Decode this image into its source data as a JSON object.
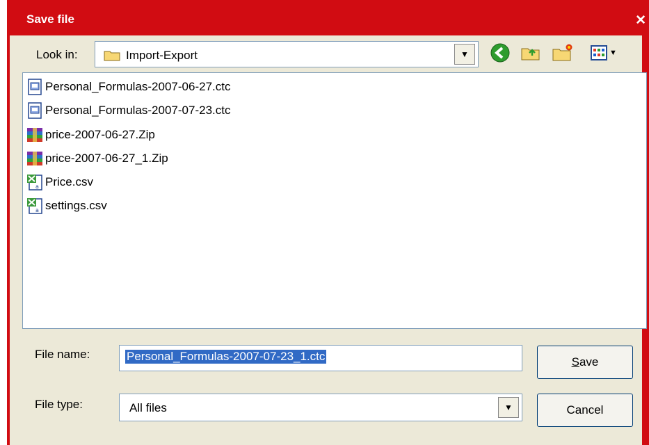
{
  "window": {
    "title": "Save file"
  },
  "toolbar": {
    "look_in_label": "Look in:",
    "look_in_value": "Import-Export",
    "buttons": [
      "back-icon",
      "up-folder-icon",
      "new-folder-icon",
      "view-menu-icon"
    ]
  },
  "files": [
    {
      "name": "Personal_Formulas-2007-06-27.ctc",
      "icon": "ctc-file-icon"
    },
    {
      "name": "Personal_Formulas-2007-07-23.ctc",
      "icon": "ctc-file-icon"
    },
    {
      "name": "price-2007-06-27.Zip",
      "icon": "zip-archive-icon"
    },
    {
      "name": "price-2007-06-27_1.Zip",
      "icon": "zip-archive-icon"
    },
    {
      "name": "Price.csv",
      "icon": "csv-file-icon"
    },
    {
      "name": "settings.csv",
      "icon": "csv-file-icon"
    }
  ],
  "form": {
    "file_name_label": "File name:",
    "file_name_value": "Personal_Formulas-2007-07-23_1.ctc",
    "file_type_label": "File type:",
    "file_type_value": "All files"
  },
  "buttons": {
    "save_first": "S",
    "save_rest": "ave",
    "cancel": "Cancel"
  },
  "colors": {
    "title_bar": "#d10c12",
    "selection": "#316ac5",
    "dialog_bg": "#ece9d8"
  }
}
